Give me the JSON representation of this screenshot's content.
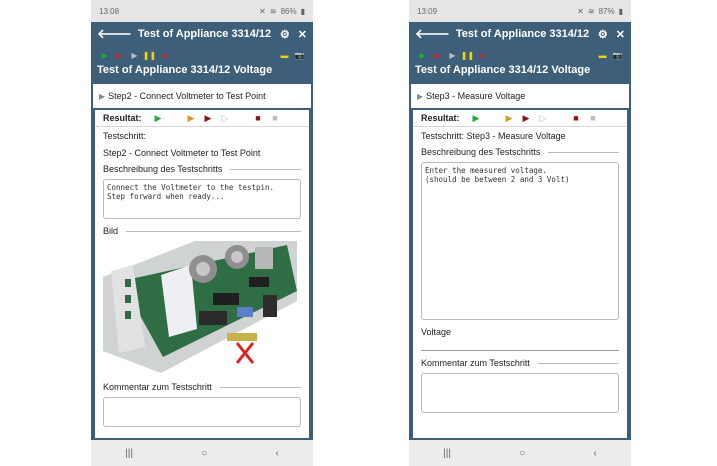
{
  "left": {
    "status": {
      "time": "13:08",
      "battery": "86%"
    },
    "appbar": {
      "title": "Test of Appliance 3314/12"
    },
    "toolbar": {
      "title": "Test of Appliance 3314/12 Voltage"
    },
    "step_label": "Step2 - Connect Voltmeter to Test Point",
    "result_label": "Resultat:",
    "testschritt_label": "Testschritt:",
    "testschritt_value": "Step2 - Connect Voltmeter to Test Point",
    "beschreibung_label": "Beschreibung des Testschritts",
    "beschreibung_text": "Connect the Voltmeter to the testpin.\nStep forward when ready...",
    "bild_label": "Bild",
    "kommentar_label": "Kommentar zum Testschritt"
  },
  "right": {
    "status": {
      "time": "13:09",
      "battery": "87%"
    },
    "appbar": {
      "title": "Test of Appliance 3314/12"
    },
    "toolbar": {
      "title": "Test of Appliance 3314/12 Voltage"
    },
    "step_label": "Step3 - Measure Voltage",
    "result_label": "Resultat:",
    "testschritt_label": "Testschritt:",
    "testschritt_value": "Step3 - Measure Voltage",
    "beschreibung_label": "Beschreibung des Testschritts",
    "beschreibung_text": "Enter the measured voltage.\n(should be between 2 and 3 Volt)",
    "voltage_label": "Voltage",
    "kommentar_label": "Kommentar zum Testschritt"
  },
  "icons": [
    "back-icon",
    "gear-icon",
    "close-icon",
    "play-icon",
    "step-forward-icon",
    "pause-icon",
    "stop-icon",
    "comment-icon",
    "camera-icon"
  ],
  "colors": {
    "appbar": "#3d5f7a",
    "play": "#22aa33",
    "pause": "#f2d200",
    "stop": "#cc2a2a"
  }
}
